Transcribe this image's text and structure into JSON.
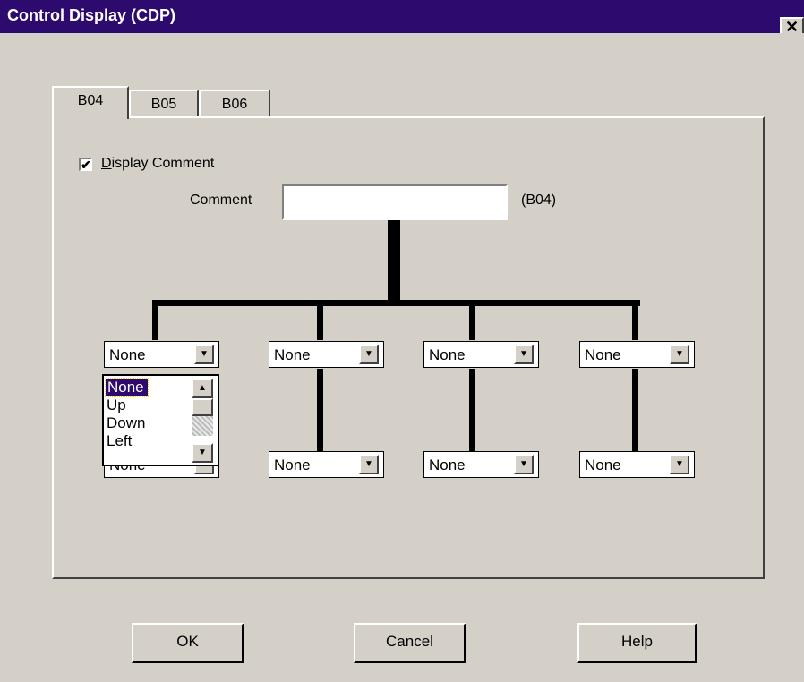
{
  "window": {
    "title": "Control Display (CDP)",
    "close_label": "✕"
  },
  "tabs": [
    {
      "label": "B04",
      "active": true
    },
    {
      "label": "B05",
      "active": false
    },
    {
      "label": "B06",
      "active": false
    }
  ],
  "display_comment": {
    "checked": true,
    "label_first": "D",
    "label_rest": "isplay Comment",
    "check_mark": "✔"
  },
  "comment": {
    "label": "Comment",
    "value": "",
    "suffix": "(B04)"
  },
  "combos": {
    "top": [
      "None",
      "None",
      "None",
      "None"
    ],
    "bottom": [
      "None",
      "None",
      "None",
      "None"
    ],
    "arrow_glyph": "▼"
  },
  "dropdown_list": {
    "items": [
      "None",
      "Up",
      "Down",
      "Left"
    ],
    "selected_index": 0,
    "scroll_up": "▲",
    "scroll_down": "▼"
  },
  "buttons": {
    "ok": "OK",
    "cancel": "Cancel",
    "help": "Help"
  }
}
